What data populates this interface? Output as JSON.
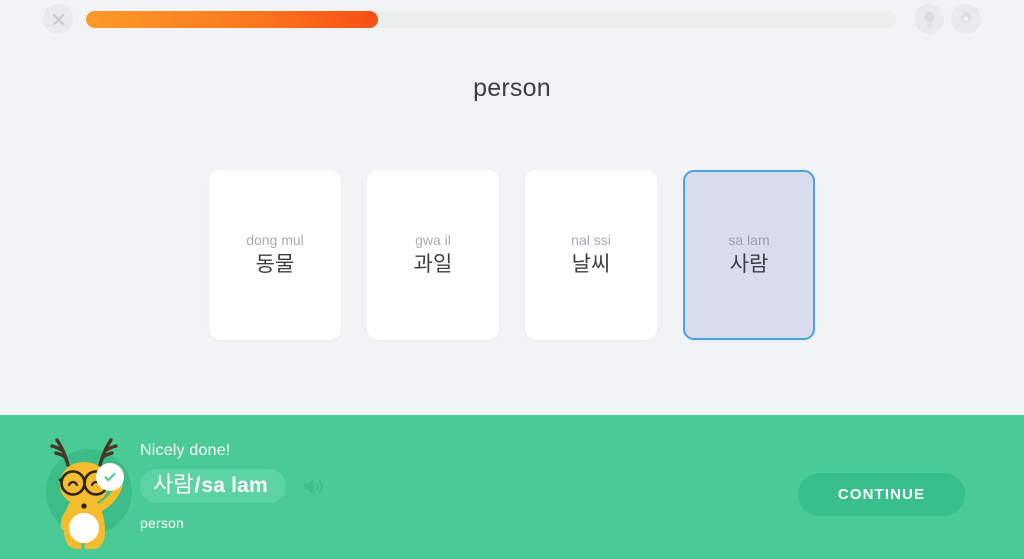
{
  "topbar": {
    "close_icon": "close-x-icon",
    "hint_icon": "lightbulb-icon",
    "settings_icon": "gear-icon",
    "progress_percent": 36,
    "progress_gradient_from": "#fb9a27",
    "progress_gradient_to": "#f74f14",
    "progress_track_color": "#eceded"
  },
  "exercise": {
    "prompt": "person",
    "cards": [
      {
        "romanization": "dong mul",
        "word": "동물",
        "selected": false
      },
      {
        "romanization": "gwa il",
        "word": "과일",
        "selected": false
      },
      {
        "romanization": "nal ssi",
        "word": "날씨",
        "selected": false
      },
      {
        "romanization": "sa lam",
        "word": "사람",
        "selected": true
      }
    ],
    "selected_border_color": "#4aa3e0",
    "selected_fill_color": "#d8dced"
  },
  "feedback": {
    "banner_color": "#4aca95",
    "headline": "Nicely done!",
    "answer_word": "사람",
    "answer_separator": "/",
    "answer_romanization": "sa lam",
    "meaning": "person",
    "speaker_icon": "speaker-icon",
    "mascot_icon": "deer-mascot-icon",
    "check_icon": "check-circle-icon",
    "continue_label": "CONTINUE",
    "continue_color": "#38bf8c"
  }
}
